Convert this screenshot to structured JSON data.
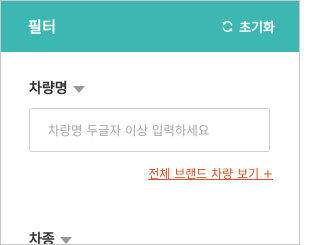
{
  "header": {
    "title": "필터",
    "reset_label": "초기화",
    "reset_icon": "refresh-icon",
    "background_color": "#3cb7b2"
  },
  "vehicle_name": {
    "title": "차량명",
    "caret_icon": "caret-down-icon",
    "search_value": "",
    "search_placeholder": "차량명 두글자 이상 입력하세요",
    "brand_link": "전체 브랜드 차량 보기 +",
    "link_color": "#e0502a"
  },
  "vehicle_type": {
    "title": "차종",
    "caret_icon": "caret-down-icon"
  }
}
